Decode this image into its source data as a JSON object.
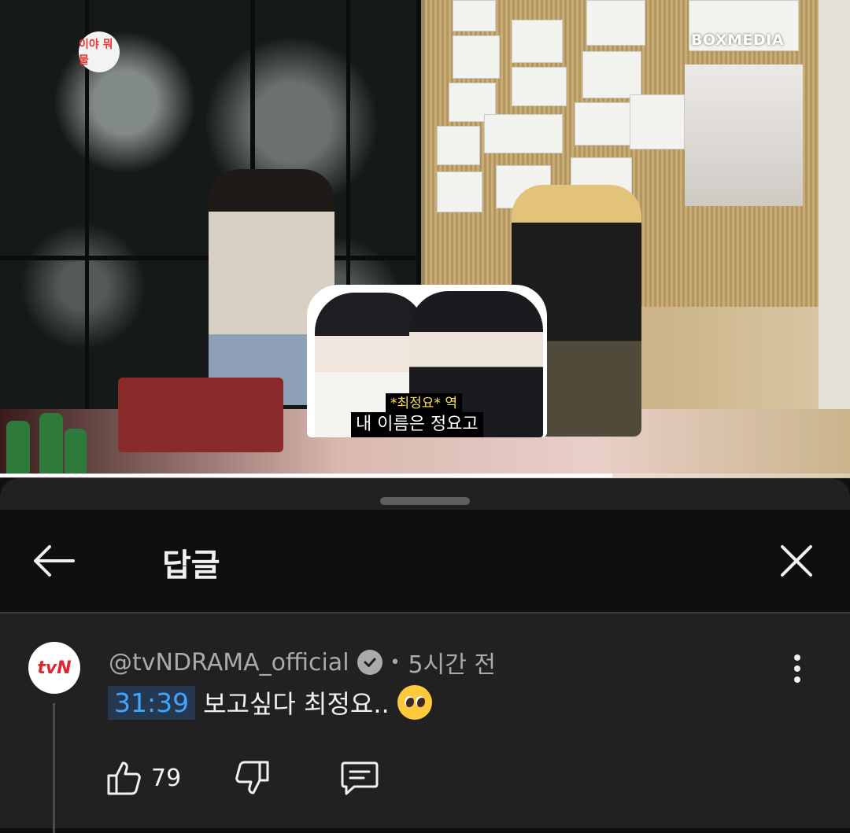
{
  "video": {
    "watermark": "BOXMEDIA",
    "channel_logo_text": "이야 뭐물",
    "caption_role": "*최정요* 역",
    "caption_line": "내 이름은 정요고",
    "progress": 0.72
  },
  "sheet": {
    "title": "답글"
  },
  "comment": {
    "avatar_text": "tvN",
    "author": "@tvNDRAMA_official",
    "time": "5시간 전",
    "timestamp_link": "31:39",
    "text": "보고싶다 최정요..",
    "likes": "79"
  },
  "colors": {
    "background": "#0f0f0f",
    "sheet": "#212121",
    "timestamp_link": "#3ea6ff",
    "timestamp_bg": "#263850",
    "tvn_red": "#e0262f"
  }
}
